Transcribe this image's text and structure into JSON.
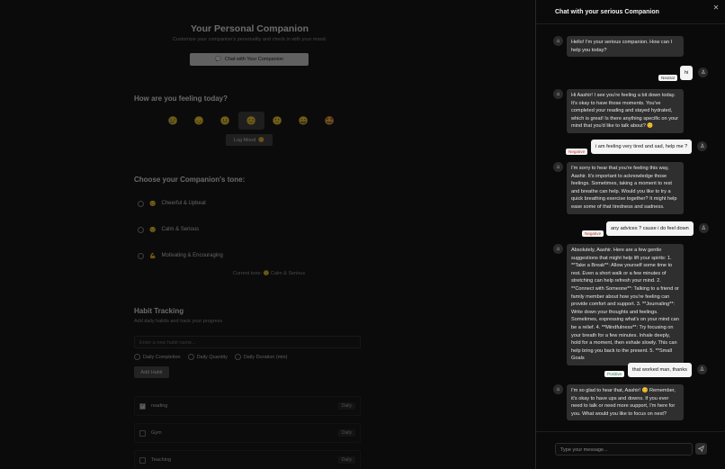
{
  "main": {
    "title": "Your Personal Companion",
    "subtitle": "Customize your companion's personality and check in with your mood.",
    "chat_button": "Chat with Your Companion",
    "mood": {
      "heading": "How are you feeling today?",
      "options": [
        "😢",
        "😞",
        "😐",
        "😊",
        "🙂",
        "😄",
        "🤩"
      ],
      "selected_index": 3,
      "log_button": "Log Mood",
      "log_button_emoji": "😊"
    },
    "tone": {
      "heading": "Choose your Companion's tone:",
      "options": [
        {
          "emoji": "😊",
          "label": "Cheerful & Upbeat"
        },
        {
          "emoji": "😌",
          "label": "Calm & Serious"
        },
        {
          "emoji": "💪",
          "label": "Motivating & Encouraging"
        }
      ],
      "current_prefix": "Current tone:",
      "current_value": "😌 Calm & Serious"
    },
    "habits": {
      "heading": "Habit Tracking",
      "subtitle": "Add daily habits and track your progress",
      "input_placeholder": "Enter a new habit name...",
      "types": [
        "Daily Completion",
        "Daily Quantity",
        "Daily Duration (min)"
      ],
      "add_button": "Add Habit",
      "items": [
        {
          "name": "reading",
          "frequency": "Daily",
          "checked": true
        },
        {
          "name": "Gym",
          "frequency": "Daily",
          "checked": false
        },
        {
          "name": "Teaching",
          "frequency": "Daily",
          "checked": false
        }
      ]
    }
  },
  "panel": {
    "title": "Chat with your serious Companion",
    "messages": [
      {
        "role": "bot",
        "text": "Hello! I'm your serious companion. How can I help you today?"
      },
      {
        "role": "user",
        "text": "hi",
        "sentiment": "Neutral"
      },
      {
        "role": "bot",
        "text": "Hi Aashir! I see you're feeling a bit down today. It's okay to have those moments. You've completed your reading and stayed hydrated, which is great! Is there anything specific on your mind that you'd like to talk about? 😊"
      },
      {
        "role": "user",
        "text": "i am feeling very tired and sad, help me ?",
        "sentiment": "Negative"
      },
      {
        "role": "bot",
        "text": "I'm sorry to hear that you're feeling this way, Aashir. It's important to acknowledge those feelings. Sometimes, taking a moment to rest and breathe can help. Would you like to try a quick breathing exercise together? It might help ease some of that tiredness and sadness."
      },
      {
        "role": "user",
        "text": "any advices ? cause i do feel down",
        "sentiment": "Negative"
      },
      {
        "role": "bot",
        "text": "Absolutely, Aashir. Here are a few gentle suggestions that might help lift your spirits: 1. **Take a Break**: Allow yourself some time to rest. Even a short walk or a few minutes of stretching can help refresh your mind. 2. **Connect with Someone**: Talking to a friend or family member about how you're feeling can provide comfort and support. 3. **Journaling**: Write down your thoughts and feelings. Sometimes, expressing what's on your mind can be a relief. 4. **Mindfulness**: Try focusing on your breath for a few minutes. Inhale deeply, hold for a moment, then exhale slowly. This can help bring you back to the present. 5. **Small Goals"
      },
      {
        "role": "user",
        "text": "that worked man, thanks",
        "sentiment": "Positive"
      },
      {
        "role": "bot",
        "text": "I'm so glad to hear that, Aashir! 😊 Remember, it's okay to have ups and downs. If you ever need to talk or need more support, I'm here for you. What would you like to focus on next?"
      }
    ],
    "input_placeholder": "Type your message..."
  }
}
